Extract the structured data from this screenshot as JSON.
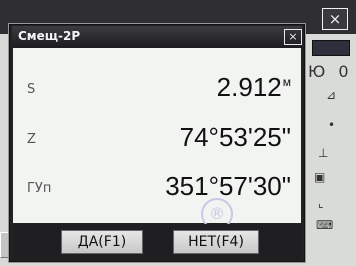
{
  "dialog": {
    "title": "Смещ-2Р",
    "close_glyph": "×",
    "rows": [
      {
        "label": "S",
        "value": "2.912",
        "unit": "м"
      },
      {
        "label": "Z",
        "value": "74°53'25\""
      },
      {
        "label": "ГУп",
        "value": "351°57'30\""
      }
    ],
    "yes_button_label": "ДА(F1)",
    "no_button_label": "НЕТ(F4)"
  },
  "background": {
    "close_glyph": "×",
    "right_panel_text": "Ю 0"
  },
  "icons": [
    "close-icon",
    "battery-icon",
    "registered-mark-icon"
  ],
  "colors": {
    "titlebar": "#2f2f31",
    "dialog_frame": "#222222",
    "dialog_body": "#f2f4f2",
    "button_face": "#d8d8d8"
  }
}
